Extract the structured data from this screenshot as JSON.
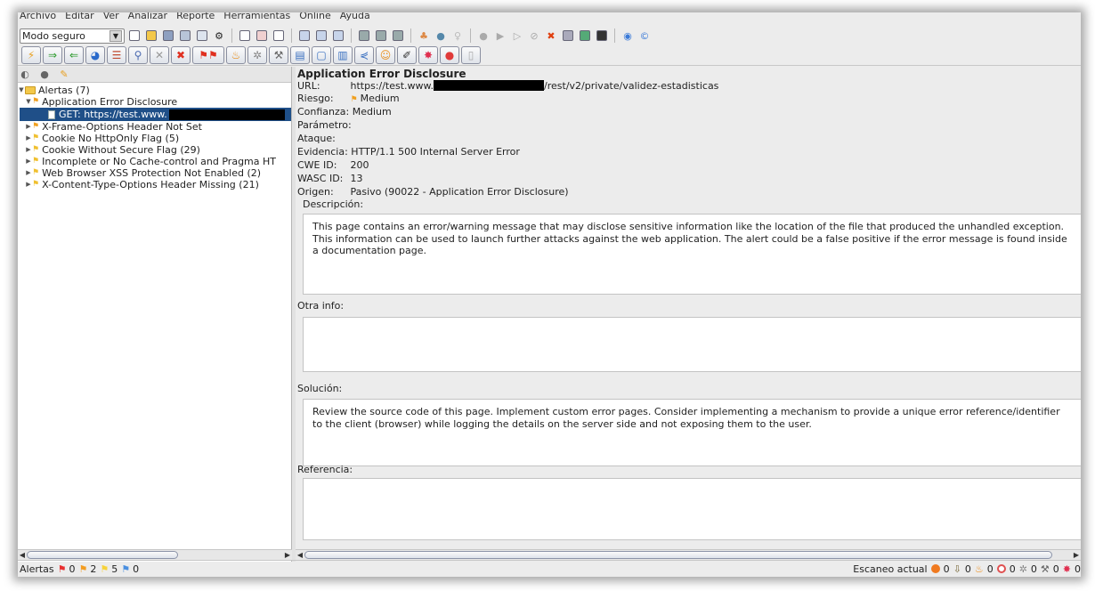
{
  "menu": [
    "Archivo",
    "Editar",
    "Ver",
    "Analizar",
    "Reporte",
    "Herramientas",
    "Online",
    "Ayuda"
  ],
  "mode": {
    "value": "Modo seguro"
  },
  "left_tree": {
    "root_label": "Alertas (7)",
    "items": [
      {
        "label": "Application Error Disclosure",
        "expanded": true,
        "children": [
          {
            "label": "GET: https://test.www."
          }
        ]
      },
      {
        "label": "X-Frame-Options Header Not Set"
      },
      {
        "label": "Cookie No HttpOnly Flag (5)"
      },
      {
        "label": "Cookie Without Secure Flag (29)"
      },
      {
        "label": "Incomplete or No Cache-control and Pragma HT"
      },
      {
        "label": "Web Browser XSS Protection Not Enabled (2)"
      },
      {
        "label": "X-Content-Type-Options Header Missing (21)"
      }
    ]
  },
  "detail": {
    "title": "Application Error Disclosure",
    "fields": {
      "url_label": "URL:",
      "url_prefix": "https://test.www.",
      "url_suffix": "/rest/v2/private/validez-estadisticas",
      "riesgo_label": "Riesgo:",
      "riesgo_value": "Medium",
      "confianza_label": "Confianza:",
      "confianza_value": "Medium",
      "parametro_label": "Parámetro:",
      "ataque_label": "Ataque:",
      "evidencia_label": "Evidencia:",
      "evidencia_value": "HTTP/1.1 500 Internal Server Error",
      "cwe_label": "CWE ID:",
      "cwe_value": "200",
      "wasc_label": "WASC ID:",
      "wasc_value": "13",
      "origen_label": "Origen:",
      "origen_value": "Pasivo (90022 - Application Error Disclosure)"
    },
    "descripcion_label": "Descripción:",
    "descripcion": "This page contains an error/warning message that may disclose sensitive information like the location of the file that produced the unhandled exception. This information can be used to launch further attacks against the web application. The alert could be a false positive if the error message is found inside a documentation page.",
    "otra_info_label": "Otra info:",
    "otra_info": "",
    "solucion_label": "Solución:",
    "solucion": "Review the source code of this page. Implement custom error pages. Consider implementing a mechanism to provide a unique error reference/identifier to the client (browser) while logging the details on the server side and not exposing them to the user.",
    "referencia_label": "Referencia:",
    "referencia": ""
  },
  "statusbar": {
    "alerts_label": "Alertas",
    "counts": [
      "0",
      "2",
      "5",
      "0"
    ],
    "scan_label": "Escaneo actual",
    "scan_counts": [
      "0",
      "0",
      "0",
      "0",
      "0",
      "0",
      "0"
    ]
  },
  "colors": {
    "flag_high": "#e83030",
    "flag_medium": "#f39c1f",
    "flag_low": "#f7d23a",
    "flag_info": "#4a8fe0",
    "selection": "#1f4f88"
  }
}
